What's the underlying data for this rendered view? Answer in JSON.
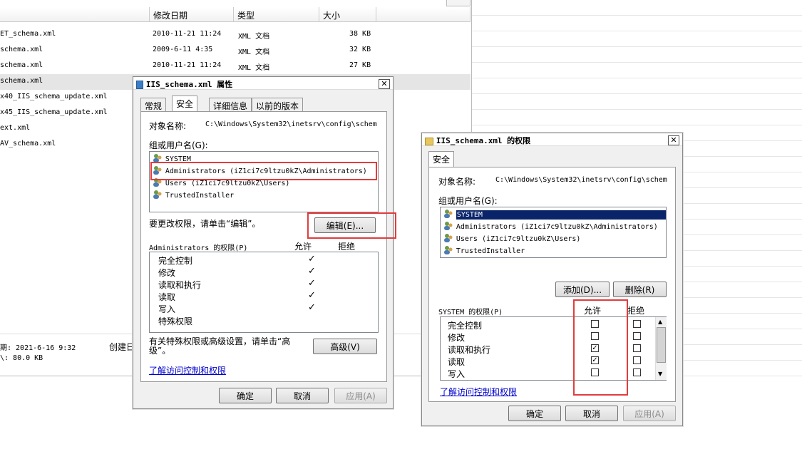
{
  "explorer": {
    "columns": {
      "modified": "修改日期",
      "type": "类型",
      "size": "大小"
    },
    "files": [
      {
        "name": "ET_schema.xml",
        "date": "2010-11-21 11:24",
        "type": "XML 文档",
        "size": "38 KB"
      },
      {
        "name": "schema.xml",
        "date": "2009-6-11 4:35",
        "type": "XML 文档",
        "size": "32 KB"
      },
      {
        "name": "schema.xml",
        "date": "2010-11-21 11:24",
        "type": "XML 文档",
        "size": "27 KB"
      },
      {
        "name": "schema.xml",
        "date": "",
        "type": "",
        "size": ""
      },
      {
        "name": "x40_IIS_schema_update.xml",
        "date": "",
        "type": "",
        "size": ""
      },
      {
        "name": "x45_IIS_schema_update.xml",
        "date": "",
        "type": "",
        "size": ""
      },
      {
        "name": "ext.xml",
        "date": "",
        "type": "",
        "size": ""
      },
      {
        "name": "AV_schema.xml",
        "date": "",
        "type": "",
        "size": ""
      }
    ],
    "status_line1": "期: 2021-6-16 9:32",
    "status_line1b": "创建日",
    "status_line2": "\\: 80.0 KB"
  },
  "props": {
    "title": "IIS_schema.xml 属性",
    "tabs": [
      "常规",
      "安全",
      "详细信息",
      "以前的版本"
    ],
    "object_label": "对象名称:",
    "object_value": "C:\\Windows\\System32\\inetsrv\\config\\schem",
    "group_label": "组或用户名(G):",
    "users": [
      "SYSTEM",
      "Administrators (iZ1ci7c9ltzu0kZ\\Administrators)",
      "Users (iZ1ci7c9ltzu0kZ\\Users)",
      "TrustedInstaller"
    ],
    "change_text": "要更改权限，请单击“编辑”。",
    "edit_button": "编辑(E)...",
    "perm_header": "Administrators 的权限(P)",
    "allow": "允许",
    "deny": "拒绝",
    "perms": [
      "完全控制",
      "修改",
      "读取和执行",
      "读取",
      "写入",
      "特殊权限"
    ],
    "check": "✓",
    "advanced_text": "有关特殊权限或高级设置，请单击“高级”。",
    "advanced_button": "高级(V)",
    "link": "了解访问控制和权限",
    "ok": "确定",
    "cancel": "取消",
    "apply": "应用(A)"
  },
  "perm": {
    "title": "IIS_schema.xml 的权限",
    "tab": "安全",
    "object_label": "对象名称:",
    "object_value": "C:\\Windows\\System32\\inetsrv\\config\\schem",
    "group_label": "组或用户名(G):",
    "users": [
      "SYSTEM",
      "Administrators (iZ1ci7c9ltzu0kZ\\Administrators)",
      "Users (iZ1ci7c9ltzu0kZ\\Users)",
      "TrustedInstaller"
    ],
    "add_button": "添加(D)...",
    "remove_button": "删除(R)",
    "perm_header": "SYSTEM 的权限(P)",
    "allow": "允许",
    "deny": "拒绝",
    "perms": [
      "完全控制",
      "修改",
      "读取和执行",
      "读取",
      "写入"
    ],
    "allow_checked": [
      false,
      false,
      true,
      true,
      false
    ],
    "check": "✓",
    "link": "了解访问控制和权限",
    "ok": "确定",
    "cancel": "取消",
    "apply": "应用(A)"
  },
  "colors": {
    "highlight": "#e23c3c",
    "selection": "#0a246a",
    "link": "#0000cc"
  }
}
